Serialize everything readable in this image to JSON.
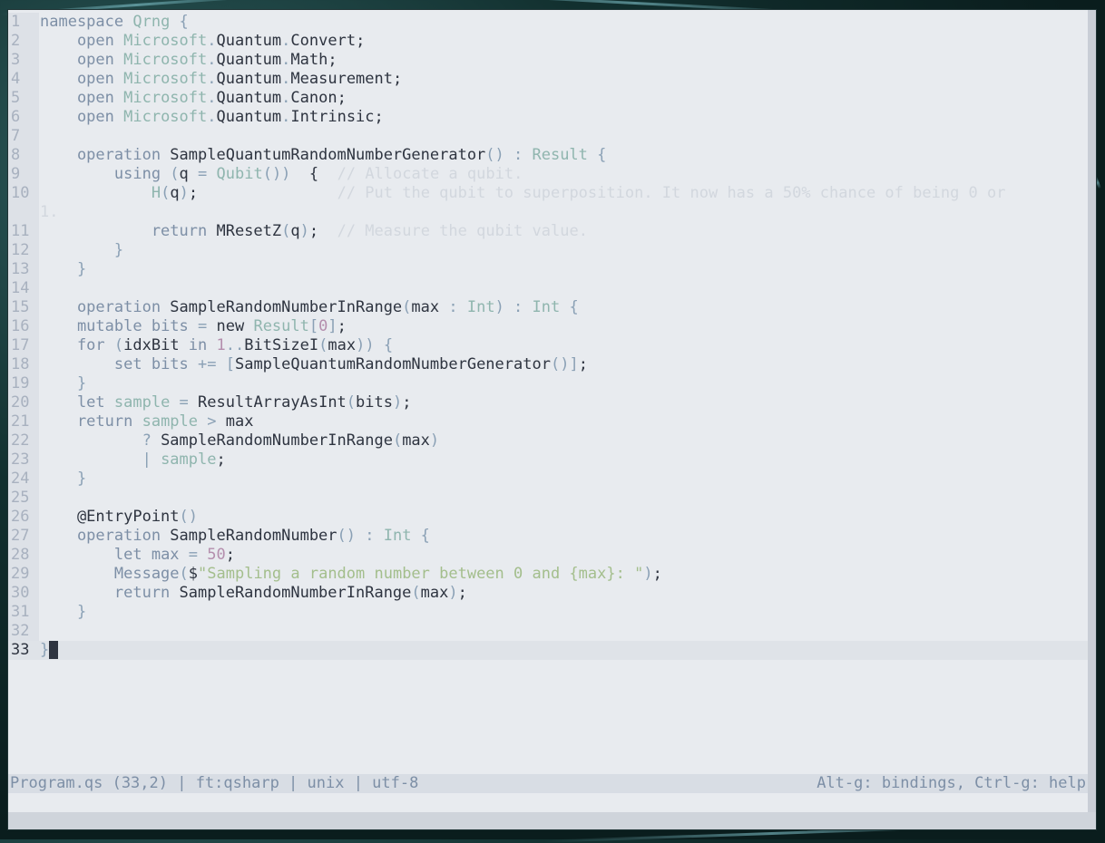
{
  "editor": {
    "lines": [
      {
        "n": "1",
        "segs": [
          [
            "kw",
            "namespace "
          ],
          [
            "ty",
            "Qrng "
          ],
          [
            "pu",
            "{"
          ]
        ]
      },
      {
        "n": "2",
        "segs": [
          [
            "kw",
            "    open "
          ],
          [
            "ty",
            "Microsoft"
          ],
          [
            "pu",
            "."
          ],
          [
            "id",
            "Quantum"
          ],
          [
            "pu",
            "."
          ],
          [
            "id",
            "Convert"
          ],
          [
            "id",
            ";"
          ]
        ]
      },
      {
        "n": "3",
        "segs": [
          [
            "kw",
            "    open "
          ],
          [
            "ty",
            "Microsoft"
          ],
          [
            "pu",
            "."
          ],
          [
            "id",
            "Quantum"
          ],
          [
            "pu",
            "."
          ],
          [
            "id",
            "Math"
          ],
          [
            "id",
            ";"
          ]
        ]
      },
      {
        "n": "4",
        "segs": [
          [
            "kw",
            "    open "
          ],
          [
            "ty",
            "Microsoft"
          ],
          [
            "pu",
            "."
          ],
          [
            "id",
            "Quantum"
          ],
          [
            "pu",
            "."
          ],
          [
            "id",
            "Measurement"
          ],
          [
            "id",
            ";"
          ]
        ]
      },
      {
        "n": "5",
        "segs": [
          [
            "kw",
            "    open "
          ],
          [
            "ty",
            "Microsoft"
          ],
          [
            "pu",
            "."
          ],
          [
            "id",
            "Quantum"
          ],
          [
            "pu",
            "."
          ],
          [
            "id",
            "Canon"
          ],
          [
            "id",
            ";"
          ]
        ]
      },
      {
        "n": "6",
        "segs": [
          [
            "kw",
            "    open "
          ],
          [
            "ty",
            "Microsoft"
          ],
          [
            "pu",
            "."
          ],
          [
            "id",
            "Quantum"
          ],
          [
            "pu",
            "."
          ],
          [
            "id",
            "Intrinsic"
          ],
          [
            "id",
            ";"
          ]
        ]
      },
      {
        "n": "7",
        "segs": []
      },
      {
        "n": "8",
        "segs": [
          [
            "kw",
            "    operation "
          ],
          [
            "id",
            "SampleQuantumRandomNumberGenerator"
          ],
          [
            "pu",
            "() : "
          ],
          [
            "ty",
            "Result "
          ],
          [
            "pu",
            "{"
          ]
        ]
      },
      {
        "n": "9",
        "segs": [
          [
            "kw",
            "        using "
          ],
          [
            "pu",
            "("
          ],
          [
            "id",
            "q "
          ],
          [
            "pu",
            "= "
          ],
          [
            "ty",
            "Qubit"
          ],
          [
            "pu",
            "()) "
          ],
          [
            "id",
            " {  "
          ],
          [
            "cm",
            "// Allocate a qubit."
          ]
        ]
      },
      {
        "n": "10",
        "segs": [
          [
            "ty",
            "            H"
          ],
          [
            "pu",
            "("
          ],
          [
            "id",
            "q"
          ],
          [
            "pu",
            ")"
          ],
          [
            "id",
            ";               "
          ],
          [
            "cm",
            "// Put the qubit to superposition. It now has a 50% chance of being 0 or"
          ]
        ]
      },
      {
        "n": "",
        "segs": [
          [
            "cm",
            "1."
          ]
        ]
      },
      {
        "n": "11",
        "segs": [
          [
            "kw",
            "            return "
          ],
          [
            "id",
            "MResetZ"
          ],
          [
            "pu",
            "("
          ],
          [
            "id",
            "q"
          ],
          [
            "pu",
            ")"
          ],
          [
            "id",
            ";  "
          ],
          [
            "cm",
            "// Measure the qubit value."
          ]
        ]
      },
      {
        "n": "12",
        "segs": [
          [
            "pu",
            "        }"
          ]
        ]
      },
      {
        "n": "13",
        "segs": [
          [
            "pu",
            "    }"
          ]
        ]
      },
      {
        "n": "14",
        "segs": []
      },
      {
        "n": "15",
        "segs": [
          [
            "kw",
            "    operation "
          ],
          [
            "id",
            "SampleRandomNumberInRange"
          ],
          [
            "pu",
            "("
          ],
          [
            "id",
            "max "
          ],
          [
            "pu",
            ": "
          ],
          [
            "ty",
            "Int"
          ],
          [
            "pu",
            ") : "
          ],
          [
            "ty",
            "Int "
          ],
          [
            "pu",
            "{"
          ]
        ]
      },
      {
        "n": "16",
        "segs": [
          [
            "kw",
            "    mutable "
          ],
          [
            "kw",
            "bits "
          ],
          [
            "pu",
            "= "
          ],
          [
            "id",
            "new "
          ],
          [
            "ty",
            "Result"
          ],
          [
            "pu",
            "["
          ],
          [
            "nu",
            "0"
          ],
          [
            "pu",
            "]"
          ],
          [
            "id",
            ";"
          ]
        ]
      },
      {
        "n": "17",
        "segs": [
          [
            "kw",
            "    for "
          ],
          [
            "pu",
            "("
          ],
          [
            "id",
            "idxBit "
          ],
          [
            "kw",
            "in "
          ],
          [
            "nu",
            "1"
          ],
          [
            "pu",
            ".."
          ],
          [
            "id",
            "BitSizeI"
          ],
          [
            "pu",
            "("
          ],
          [
            "id",
            "max"
          ],
          [
            "pu",
            ")) {"
          ]
        ]
      },
      {
        "n": "18",
        "segs": [
          [
            "kw",
            "        set "
          ],
          [
            "kw",
            "bits "
          ],
          [
            "pu",
            "+= ["
          ],
          [
            "id",
            "SampleQuantumRandomNumberGenerator"
          ],
          [
            "pu",
            "()]"
          ],
          [
            "id",
            ";"
          ]
        ]
      },
      {
        "n": "19",
        "segs": [
          [
            "pu",
            "    }"
          ]
        ]
      },
      {
        "n": "20",
        "segs": [
          [
            "kw",
            "    let "
          ],
          [
            "ty",
            "sample "
          ],
          [
            "pu",
            "= "
          ],
          [
            "id",
            "ResultArrayAsInt"
          ],
          [
            "pu",
            "("
          ],
          [
            "id",
            "bits"
          ],
          [
            "pu",
            ")"
          ],
          [
            "id",
            ";"
          ]
        ]
      },
      {
        "n": "21",
        "segs": [
          [
            "kw",
            "    return "
          ],
          [
            "ty",
            "sample "
          ],
          [
            "pu",
            "> "
          ],
          [
            "id",
            "max"
          ]
        ]
      },
      {
        "n": "22",
        "segs": [
          [
            "pu",
            "           ? "
          ],
          [
            "id",
            "SampleRandomNumberInRange"
          ],
          [
            "pu",
            "("
          ],
          [
            "id",
            "max"
          ],
          [
            "pu",
            ")"
          ]
        ]
      },
      {
        "n": "23",
        "segs": [
          [
            "pu",
            "           | "
          ],
          [
            "ty",
            "sample"
          ],
          [
            "id",
            ";"
          ]
        ]
      },
      {
        "n": "24",
        "segs": [
          [
            "pu",
            "    }"
          ]
        ]
      },
      {
        "n": "25",
        "segs": []
      },
      {
        "n": "26",
        "segs": [
          [
            "id",
            "    @EntryPoint"
          ],
          [
            "pu",
            "()"
          ]
        ]
      },
      {
        "n": "27",
        "segs": [
          [
            "kw",
            "    operation "
          ],
          [
            "id",
            "SampleRandomNumber"
          ],
          [
            "pu",
            "() : "
          ],
          [
            "ty",
            "Int "
          ],
          [
            "pu",
            "{"
          ]
        ]
      },
      {
        "n": "28",
        "segs": [
          [
            "kw",
            "        let "
          ],
          [
            "kw",
            "max "
          ],
          [
            "pu",
            "= "
          ],
          [
            "nu",
            "50"
          ],
          [
            "id",
            ";"
          ]
        ]
      },
      {
        "n": "29",
        "segs": [
          [
            "kw",
            "        Message"
          ],
          [
            "pu",
            "("
          ],
          [
            "id",
            "$"
          ],
          [
            "st",
            "\"Sampling a random number between 0 and {max}: \""
          ],
          [
            "pu",
            ")"
          ],
          [
            "id",
            ";"
          ]
        ]
      },
      {
        "n": "30",
        "segs": [
          [
            "kw",
            "        return "
          ],
          [
            "id",
            "SampleRandomNumberInRange"
          ],
          [
            "pu",
            "("
          ],
          [
            "id",
            "max"
          ],
          [
            "pu",
            ")"
          ],
          [
            "id",
            ";"
          ]
        ]
      },
      {
        "n": "31",
        "segs": [
          [
            "pu",
            "    }"
          ]
        ]
      },
      {
        "n": "32",
        "segs": []
      },
      {
        "n": "33",
        "segs": [
          [
            "pu",
            "}"
          ]
        ],
        "current": true
      }
    ]
  },
  "statusbar": {
    "left": "Program.qs (33,2) | ft:qsharp | unix | utf-8",
    "right": "Alt-g: bindings, Ctrl-g: help"
  }
}
